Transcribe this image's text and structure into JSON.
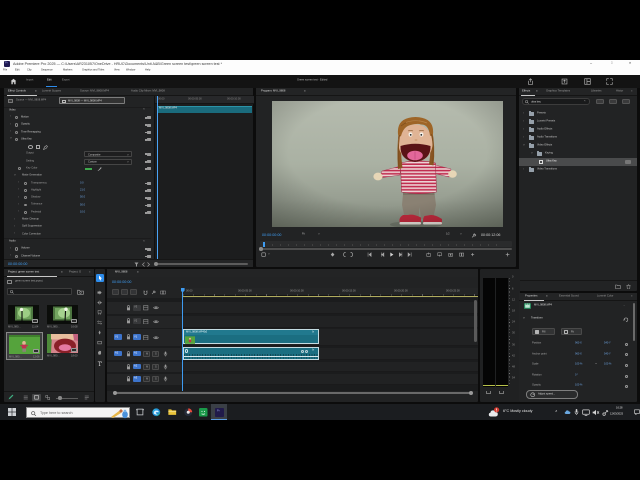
{
  "icons": {
    "menu": "≡",
    "chevron_right": "›",
    "chevron_down": "⌄",
    "caret_down": "∨",
    "caret_right": ">",
    "dots": "...",
    "collapse_up": "∧",
    "double_chevron": "»",
    "minimize": "–",
    "maximize": "□",
    "close": "×",
    "clear": "×",
    "fx": "fx",
    "link": "⚭"
  },
  "titlebar": {
    "app_badge": "Pr",
    "title": "Adobe Premiere Pro 2025 — C:\\Users\\AR231057\\OneDrive - HRUC\\Documents\\Unit A&B\\Green screen test\\green screen test *"
  },
  "menubar": {
    "items": [
      "File",
      "Edit",
      "Clip",
      "Sequence",
      "Markers",
      "Graphics and Titles",
      "View",
      "Window",
      "Help"
    ]
  },
  "workspace": {
    "tabs": [
      "Import",
      "Edit",
      "Export"
    ],
    "project_label": "Green screen test - Edited"
  },
  "effect_controls": {
    "tabs": [
      "Effect Controls",
      "Lumetri Scopes",
      "Source: MVI_9808.MP4",
      "Audio Clip Mixer: MVI_9808"
    ],
    "source_chip": "Source — MVI_9808.MP4",
    "sequence_chip": "MVI_9808 — MVI_9808.MP4",
    "headers": {
      "video": "Video",
      "audio": "Audio"
    },
    "rows": {
      "motion": "Motion",
      "opacity": "Opacity",
      "time_remapping": "Time Remapping",
      "ultra_key": "Ultra Key",
      "output_label": "Output",
      "output_value": "Composite",
      "setting_label": "Setting",
      "setting_value": "Custom",
      "key_color": "Key Color",
      "matte_generation": "Matte Generation",
      "transparency": "Transparency",
      "transparency_value": "0.0",
      "highlight": "Highlight",
      "highlight_value": "21.0",
      "shadow": "Shadow",
      "shadow_value": "50.0",
      "tolerance": "Tolerance",
      "tolerance_value": "50.0",
      "pedestal": "Pedestal",
      "pedestal_value": "10.0",
      "matte_cleanup": "Matte Cleanup",
      "spill_suppression": "Spill Suppression",
      "color_correction": "Color Correction",
      "volume": "Volume",
      "channel_volume": "Channel Volume"
    },
    "mini_ruler": [
      "00:00",
      "00:00:05:00",
      "00:00:10:00"
    ],
    "clip_label": "MVI_9808.MP4",
    "timecode": "00:00:00:00"
  },
  "program": {
    "tab": "Program: MVI_9808",
    "timecode": "00:00:00:00",
    "fit": "Fit",
    "quality": "1/2",
    "duration": "00:00:12:06"
  },
  "effects_panel": {
    "tabs": [
      "Effects",
      "Graphics Templates",
      "Libraries",
      "Histor"
    ],
    "search_value": "ultra key",
    "tree": [
      {
        "label": "Presets",
        "depth": 0
      },
      {
        "label": "Lumetri Presets",
        "depth": 0
      },
      {
        "label": "Audio Effects",
        "depth": 0
      },
      {
        "label": "Audio Transitions",
        "depth": 0
      },
      {
        "label": "Video Effects",
        "depth": 0,
        "open": true
      },
      {
        "label": "Keying",
        "depth": 1,
        "open": true
      },
      {
        "label": "Ultra Key",
        "depth": 2,
        "selected": true
      },
      {
        "label": "Video Transitions",
        "depth": 0
      }
    ]
  },
  "project_panel": {
    "tabs": [
      "Project: green screen test",
      "Project: G"
    ],
    "file_name": "green screen test.prproj",
    "clips": [
      {
        "name": "MVI_980...",
        "duration": "11:04"
      },
      {
        "name": "MVI_980...",
        "duration": "16:08"
      },
      {
        "name": "MVI_980...",
        "duration": "12:06"
      },
      {
        "name": "MVI_980...",
        "duration": "18:00"
      }
    ]
  },
  "timeline": {
    "tab": "MVI_9808",
    "timecode": "00:00:00:00",
    "ruler": [
      "00:00",
      "00:00:05:00",
      "00:00:10:00",
      "00:00:15:00",
      "00:00:20:00",
      "00:00:25:00"
    ],
    "video_tracks": [
      "V3",
      "V2",
      "V1"
    ],
    "audio_tracks": [
      "A1",
      "A2",
      "A3"
    ],
    "clip_label": "MVI_9808.MP4[V]",
    "fx_badge": "fx",
    "mute": "M",
    "solo": "S"
  },
  "meters": {
    "db_labels": [
      "0",
      "6",
      "12",
      "18",
      "24",
      "30",
      "36",
      "42",
      "48",
      "54"
    ]
  },
  "properties": {
    "tabs": [
      "Properties",
      "Essential Sound",
      "Lumetri Color"
    ],
    "clip_name": "MVI_9808.MP4",
    "section": "Transform",
    "chip_fill": "Fill",
    "chip_fit": "Fit",
    "rows": [
      {
        "label": "Position",
        "v1": "960 X",
        "v2": "540 Y"
      },
      {
        "label": "Anchor point",
        "v1": "960 X",
        "v2": "540 Y"
      },
      {
        "label": "Scale",
        "v1": "100 %",
        "v2": "100 %"
      },
      {
        "label": "Rotation",
        "v1": "0 °",
        "v2": ""
      },
      {
        "label": "Opacity",
        "v1": "100 %",
        "v2": ""
      }
    ],
    "speed_button": "Adjust speed..."
  },
  "taskbar": {
    "search_placeholder": "Type here to search",
    "weather": "6°C Mostly cloudy",
    "time": "16:28",
    "date": "12/03/2025"
  }
}
